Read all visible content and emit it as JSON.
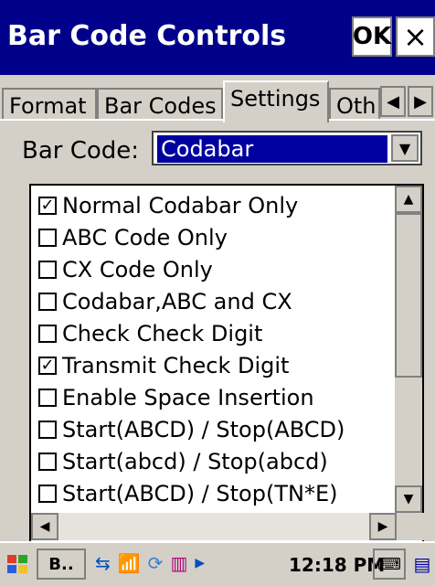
{
  "window": {
    "title": "Bar Code Controls",
    "ok_label": "OK",
    "close_label": "×"
  },
  "tabs": [
    {
      "label": "Format"
    },
    {
      "label": "Bar Codes"
    },
    {
      "label": "Settings",
      "active": true
    },
    {
      "label": "Oth"
    }
  ],
  "bar_code": {
    "label": "Bar Code:",
    "selected": "Codabar"
  },
  "options": [
    {
      "label": "Normal Codabar Only",
      "checked": true
    },
    {
      "label": "ABC Code Only",
      "checked": false
    },
    {
      "label": "CX Code Only",
      "checked": false
    },
    {
      "label": "Codabar,ABC and CX",
      "checked": false
    },
    {
      "label": "Check Check Digit",
      "checked": false
    },
    {
      "label": "Transmit Check Digit",
      "checked": true
    },
    {
      "label": "Enable Space Insertion",
      "checked": false
    },
    {
      "label": "Start(ABCD) / Stop(ABCD)",
      "checked": false
    },
    {
      "label": "Start(abcd) / Stop(abcd)",
      "checked": false
    },
    {
      "label": "Start(ABCD) / Stop(TN*E)",
      "checked": false
    }
  ],
  "taskbar": {
    "task_label": "B..",
    "time": "12:18 PM",
    "icons": [
      "start-menu-icon",
      "network-icon",
      "signal-icon",
      "sync-icon",
      "barcode-icon",
      "keyboard-icon",
      "sip-icon"
    ]
  },
  "colors": {
    "titlebar": "#00008b",
    "selection": "#0000a0",
    "face": "#d4d0c8"
  }
}
